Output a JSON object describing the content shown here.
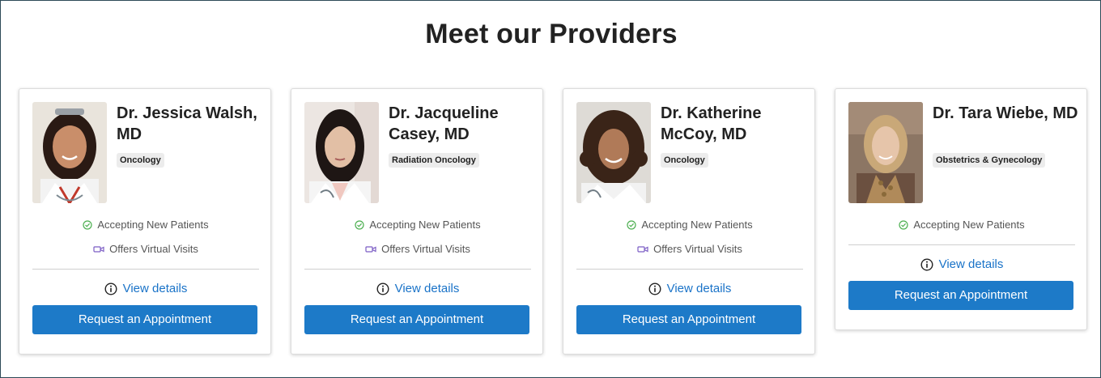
{
  "page": {
    "title": "Meet our Providers"
  },
  "labels": {
    "accepting": "Accepting New Patients",
    "virtual": "Offers Virtual Visits",
    "details": "View details",
    "request": "Request an Appointment"
  },
  "providers": [
    {
      "name": "Dr. Jessica Walsh, MD",
      "specialty": "Oncology",
      "accepting": true,
      "virtual": true
    },
    {
      "name": "Dr. Jacqueline Casey, MD",
      "specialty": "Radiation Oncology",
      "accepting": true,
      "virtual": true
    },
    {
      "name": "Dr. Katherine McCoy, MD",
      "specialty": "Oncology",
      "accepting": true,
      "virtual": true
    },
    {
      "name": "Dr. Tara Wiebe, MD",
      "specialty": "Obstetrics & Gynecology",
      "accepting": true,
      "virtual": false
    }
  ],
  "colors": {
    "accent": "#1d7ac8",
    "link": "#1a73c8",
    "check": "#4caf50",
    "video": "#7b5cc4"
  },
  "icons": {
    "accepting": "check-circle-icon",
    "virtual": "video-camera-icon",
    "details": "info-circle-icon"
  }
}
